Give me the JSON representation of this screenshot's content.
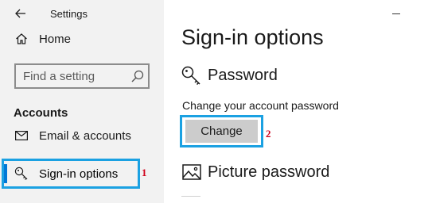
{
  "window": {
    "app_title": "Settings"
  },
  "sidebar": {
    "home_label": "Home",
    "search": {
      "placeholder": "Find a setting"
    },
    "section_label": "Accounts",
    "items": [
      {
        "label": "Email & accounts",
        "icon": "mail-icon"
      },
      {
        "label": "Sign-in options",
        "icon": "key-icon",
        "selected": true
      }
    ]
  },
  "main": {
    "title": "Sign-in options",
    "password": {
      "heading": "Password",
      "description": "Change your account password",
      "button_label": "Change"
    },
    "picture_password": {
      "heading": "Picture password"
    }
  },
  "annotations": {
    "badge_1": "1",
    "badge_2": "2"
  },
  "colors": {
    "highlight": "#1ba1e2",
    "badge": "#d0021b",
    "sidebar_bg": "#f2f2f2",
    "button_bg": "#cccccc",
    "accent": "#0078d7"
  }
}
